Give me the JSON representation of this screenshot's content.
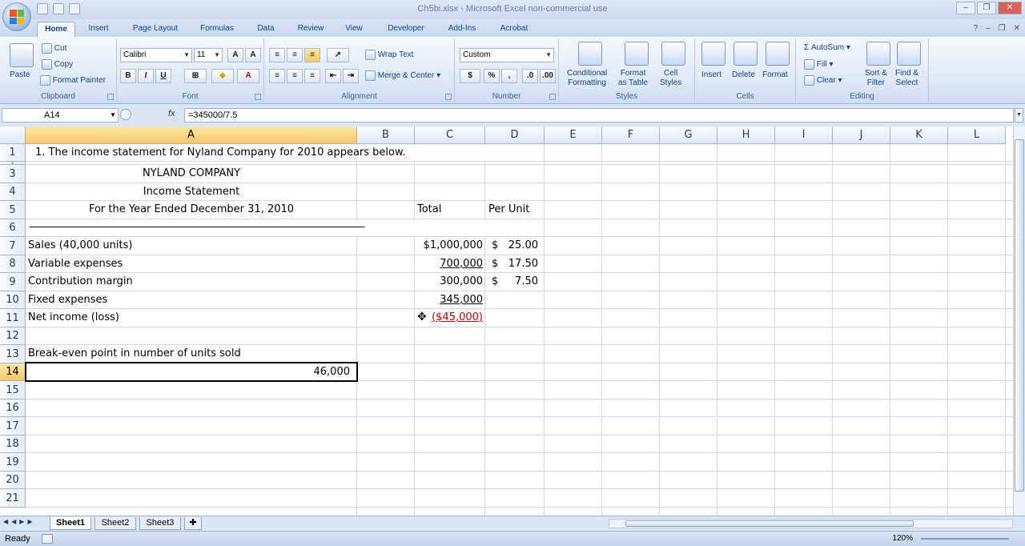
{
  "window": {
    "title": "Ch5bi.xlsx - Microsoft Excel non-commercial use"
  },
  "ribbon_tabs": [
    "Home",
    "Insert",
    "Page Layout",
    "Formulas",
    "Data",
    "Review",
    "View",
    "Developer",
    "Add-Ins",
    "Acrobat"
  ],
  "ribbon": {
    "clipboard": {
      "paste": "Paste",
      "cut": "Cut",
      "copy": "Copy",
      "format_painter": "Format Painter",
      "label": "Clipboard"
    },
    "font": {
      "font_name": "Calibri",
      "font_size": "11",
      "bold": "B",
      "italic": "I",
      "underline": "U",
      "label": "Font"
    },
    "alignment": {
      "wrap_text": "Wrap Text",
      "merge_center": "Merge & Center",
      "label": "Alignment"
    },
    "number": {
      "format": "Custom",
      "currency": "$",
      "percent": "%",
      "comma": ",",
      "label": "Number"
    },
    "styles": {
      "conditional": "Conditional",
      "conditional2": "Formatting",
      "format_as": "Format",
      "format_as2": "as Table",
      "cell": "Cell",
      "cell2": "Styles",
      "label": "Styles"
    },
    "cells": {
      "insert": "Insert",
      "delete": "Delete",
      "format": "Format",
      "label": "Cells"
    },
    "editing": {
      "autosum": "AutoSum",
      "fill": "Fill",
      "clear": "Clear",
      "sort": "Sort &",
      "sort2": "Filter",
      "find": "Find &",
      "find2": "Select",
      "label": "Editing"
    }
  },
  "formula_bar": {
    "name_box": "A14",
    "fx": "fx",
    "formula": "=345000/7.5"
  },
  "columns": [
    "A",
    "B",
    "C",
    "D",
    "E",
    "F",
    "G",
    "H",
    "I",
    "J",
    "K",
    "L"
  ],
  "rows": [
    "1",
    "2",
    "3",
    "4",
    "5",
    "6",
    "7",
    "8",
    "9",
    "10",
    "11",
    "12",
    "13",
    "14",
    "15",
    "16",
    "17",
    "18",
    "19",
    "20",
    "21"
  ],
  "cells": {
    "a1": "1. The income statement for Nyland Company for 2010 appears below.",
    "a3": "NYLAND COMPANY",
    "a4": "Income Statement",
    "a5": "For the Year Ended December 31, 2010",
    "c5": "Total",
    "d5": "Per Unit",
    "a6": "——————————————————————————————————————",
    "a7": "Sales (40,000 units)",
    "c7": "$1,000,000",
    "d7_sym": "$",
    "d7": "25.00",
    "a8": "Variable expenses",
    "c8": "700,000",
    "d8_sym": "$",
    "d8": "17.50",
    "a9": "Contribution margin",
    "c9": "300,000",
    "d9_sym": "$",
    "d9": "7.50",
    "a10": "Fixed expenses",
    "c10": "345,000",
    "a11": "Net income (loss)",
    "c11": "($45,000)",
    "a13": "Break-even point in number of units sold",
    "a14": "46,000"
  },
  "sheet_tabs": [
    "Sheet1",
    "Sheet2",
    "Sheet3"
  ],
  "status": {
    "ready": "Ready",
    "zoom": "120%"
  }
}
